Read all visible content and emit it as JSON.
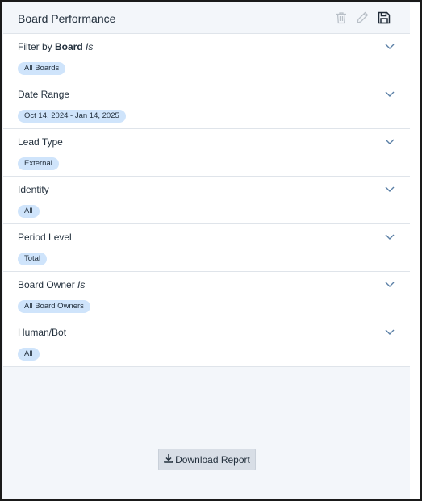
{
  "header": {
    "title": "Board Performance",
    "icons": [
      "trash-icon",
      "pencil-icon",
      "save-icon"
    ]
  },
  "filters": [
    {
      "label_prefix": "Filter by ",
      "label_bold": "Board",
      "label_italic": " Is",
      "value": "All Boards"
    },
    {
      "label": "Date Range",
      "value": "Oct 14, 2024 - Jan 14, 2025"
    },
    {
      "label": "Lead Type",
      "value": "External"
    },
    {
      "label": "Identity",
      "value": "All"
    },
    {
      "label": "Period Level",
      "value": "Total"
    },
    {
      "label_prefix": "Board Owner",
      "label_italic": " Is",
      "value": "All Board Owners"
    },
    {
      "label": "Human/Bot",
      "value": "All"
    }
  ],
  "download": {
    "label": "Download Report",
    "icon": "download-icon"
  },
  "colors": {
    "chip_bg": "#cfe4fb",
    "panel_bg": "#f3f6fa",
    "border": "#dfe4ea"
  }
}
